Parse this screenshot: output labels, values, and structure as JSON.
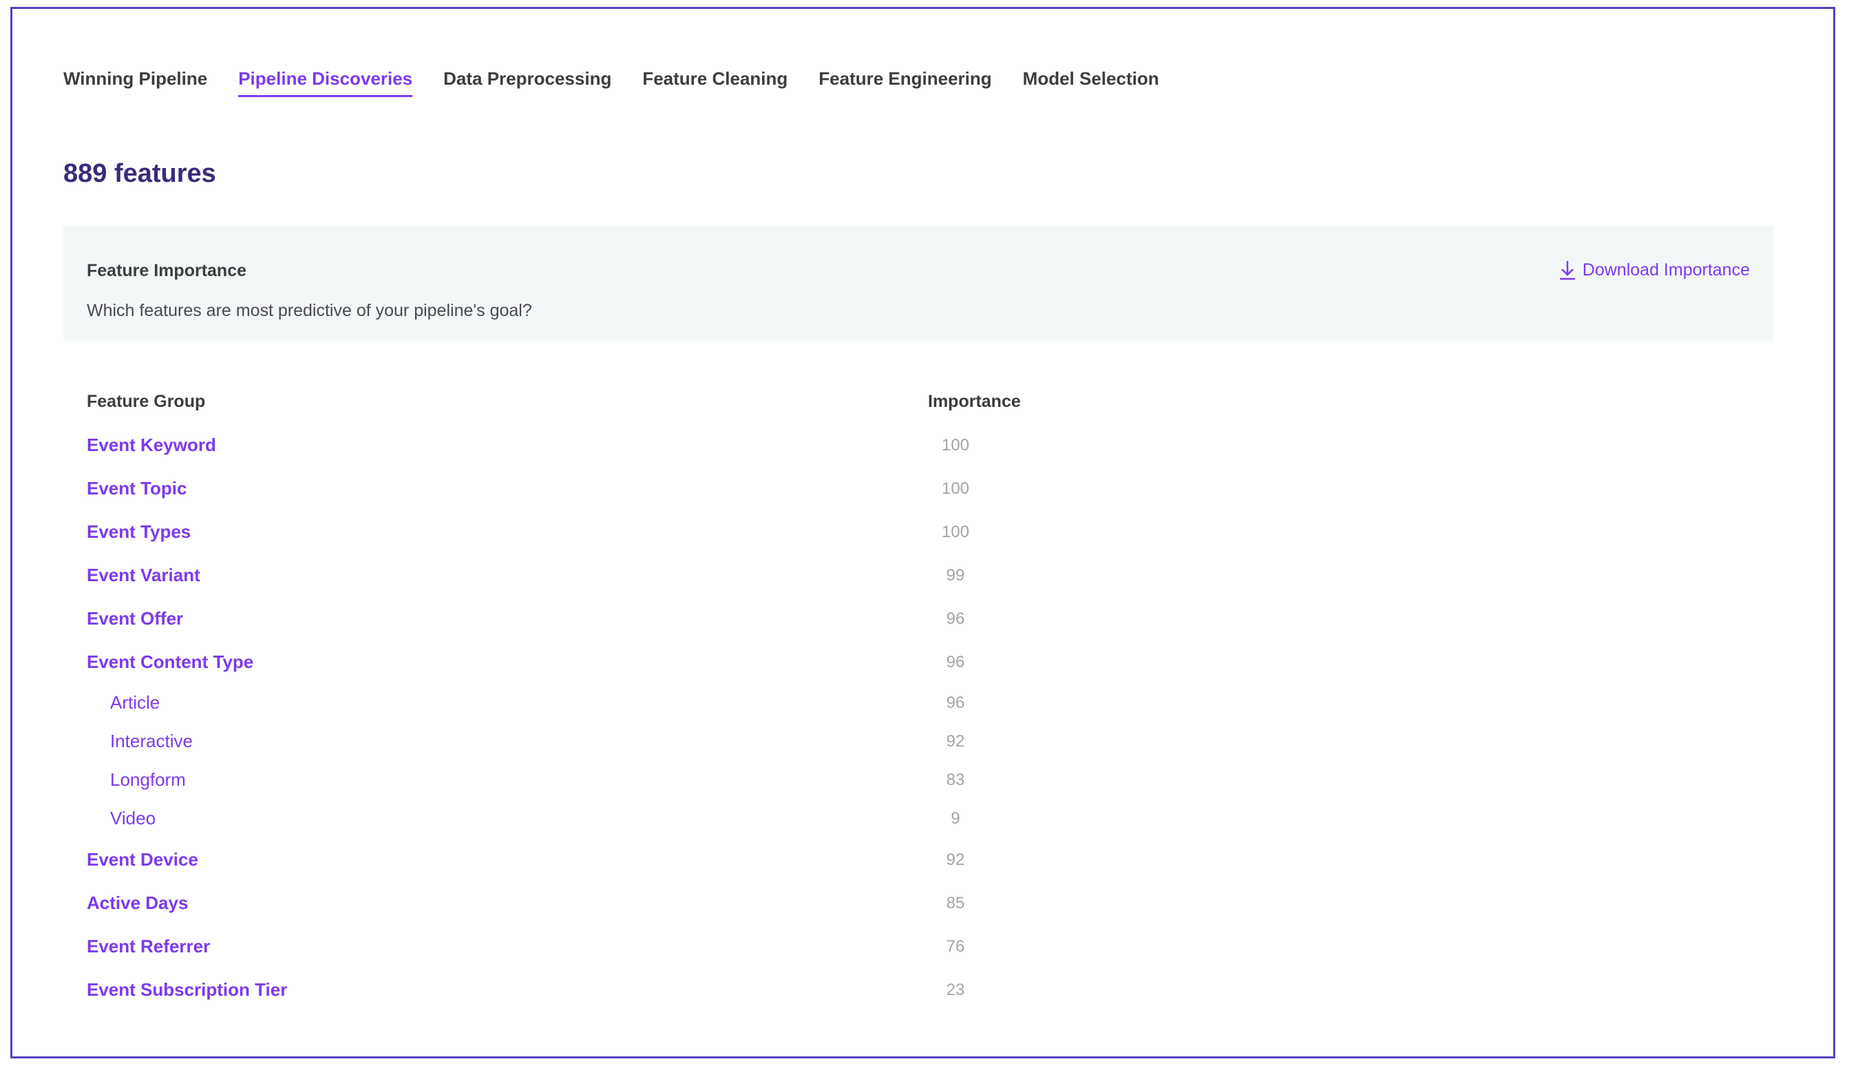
{
  "tabs": [
    {
      "label": "Winning Pipeline",
      "active": false
    },
    {
      "label": "Pipeline Discoveries",
      "active": true
    },
    {
      "label": "Data Preprocessing",
      "active": false
    },
    {
      "label": "Feature Cleaning",
      "active": false
    },
    {
      "label": "Feature Engineering",
      "active": false
    },
    {
      "label": "Model Selection",
      "active": false
    }
  ],
  "features_count_title": "889 features",
  "importance_panel": {
    "title": "Feature Importance",
    "subtitle": "Which features are most predictive of your pipeline's goal?",
    "download_label": "Download Importance",
    "download_icon": "download-icon"
  },
  "table": {
    "headers": {
      "group": "Feature Group",
      "importance": "Importance"
    },
    "rows": [
      {
        "label": "Event Keyword",
        "value": "100",
        "level": 0
      },
      {
        "label": "Event Topic",
        "value": "100",
        "level": 0
      },
      {
        "label": "Event Types",
        "value": "100",
        "level": 0
      },
      {
        "label": "Event Variant",
        "value": "99",
        "level": 0
      },
      {
        "label": "Event Offer",
        "value": "96",
        "level": 0
      },
      {
        "label": "Event Content Type",
        "value": "96",
        "level": 0
      },
      {
        "label": "Article",
        "value": "96",
        "level": 1
      },
      {
        "label": "Interactive",
        "value": "92",
        "level": 1
      },
      {
        "label": "Longform",
        "value": "83",
        "level": 1
      },
      {
        "label": "Video",
        "value": "9",
        "level": 1
      },
      {
        "label": "Event Device",
        "value": "92",
        "level": 0
      },
      {
        "label": "Active Days",
        "value": "85",
        "level": 0
      },
      {
        "label": "Event Referrer",
        "value": "76",
        "level": 0
      },
      {
        "label": "Event Subscription Tier",
        "value": "23",
        "level": 0
      }
    ]
  },
  "colors": {
    "accent": "#7c3aed",
    "title": "#3b2a7a",
    "frame": "#5a3fc0",
    "panel_bg": "#f4f7f8",
    "value_gray": "#a3a3a8"
  }
}
